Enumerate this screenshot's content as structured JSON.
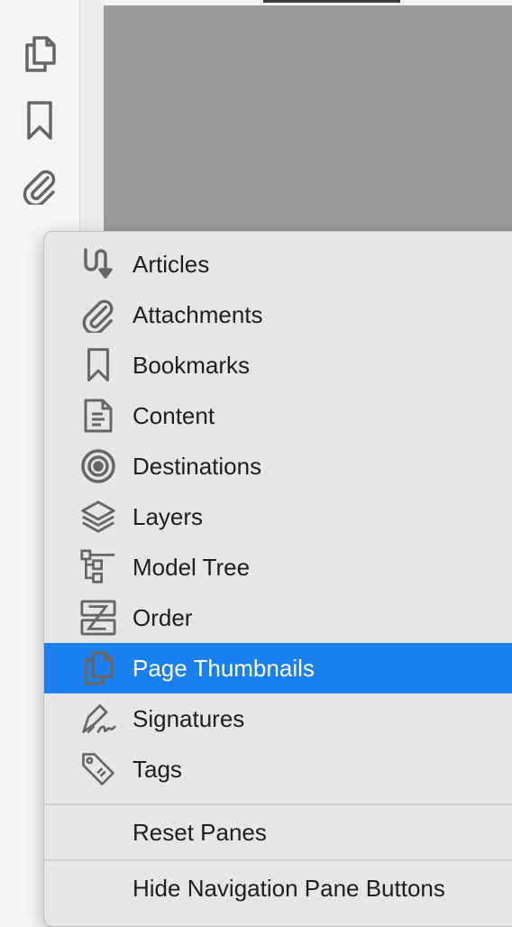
{
  "colors": {
    "selection": "#1a80f0",
    "icon_gray": "#666666",
    "document_bg": "#9a9a9a"
  },
  "nav_pane": {
    "buttons": [
      {
        "icon": "page-thumbnails-icon"
      },
      {
        "icon": "bookmark-icon"
      },
      {
        "icon": "paperclip-icon"
      }
    ]
  },
  "menu": {
    "items": [
      {
        "label": "Articles",
        "icon": "articles-icon"
      },
      {
        "label": "Attachments",
        "icon": "paperclip-icon"
      },
      {
        "label": "Bookmarks",
        "icon": "bookmark-icon"
      },
      {
        "label": "Content",
        "icon": "content-document-icon"
      },
      {
        "label": "Destinations",
        "icon": "destinations-target-icon"
      },
      {
        "label": "Layers",
        "icon": "layers-icon"
      },
      {
        "label": "Model Tree",
        "icon": "model-tree-icon"
      },
      {
        "label": "Order",
        "icon": "order-icon"
      },
      {
        "label": "Page Thumbnails",
        "icon": "page-thumbnails-icon",
        "selected": true
      },
      {
        "label": "Signatures",
        "icon": "signature-pen-icon"
      },
      {
        "label": "Tags",
        "icon": "tags-icon"
      }
    ],
    "reset_label": "Reset Panes",
    "hide_label": "Hide Navigation Pane Buttons"
  }
}
